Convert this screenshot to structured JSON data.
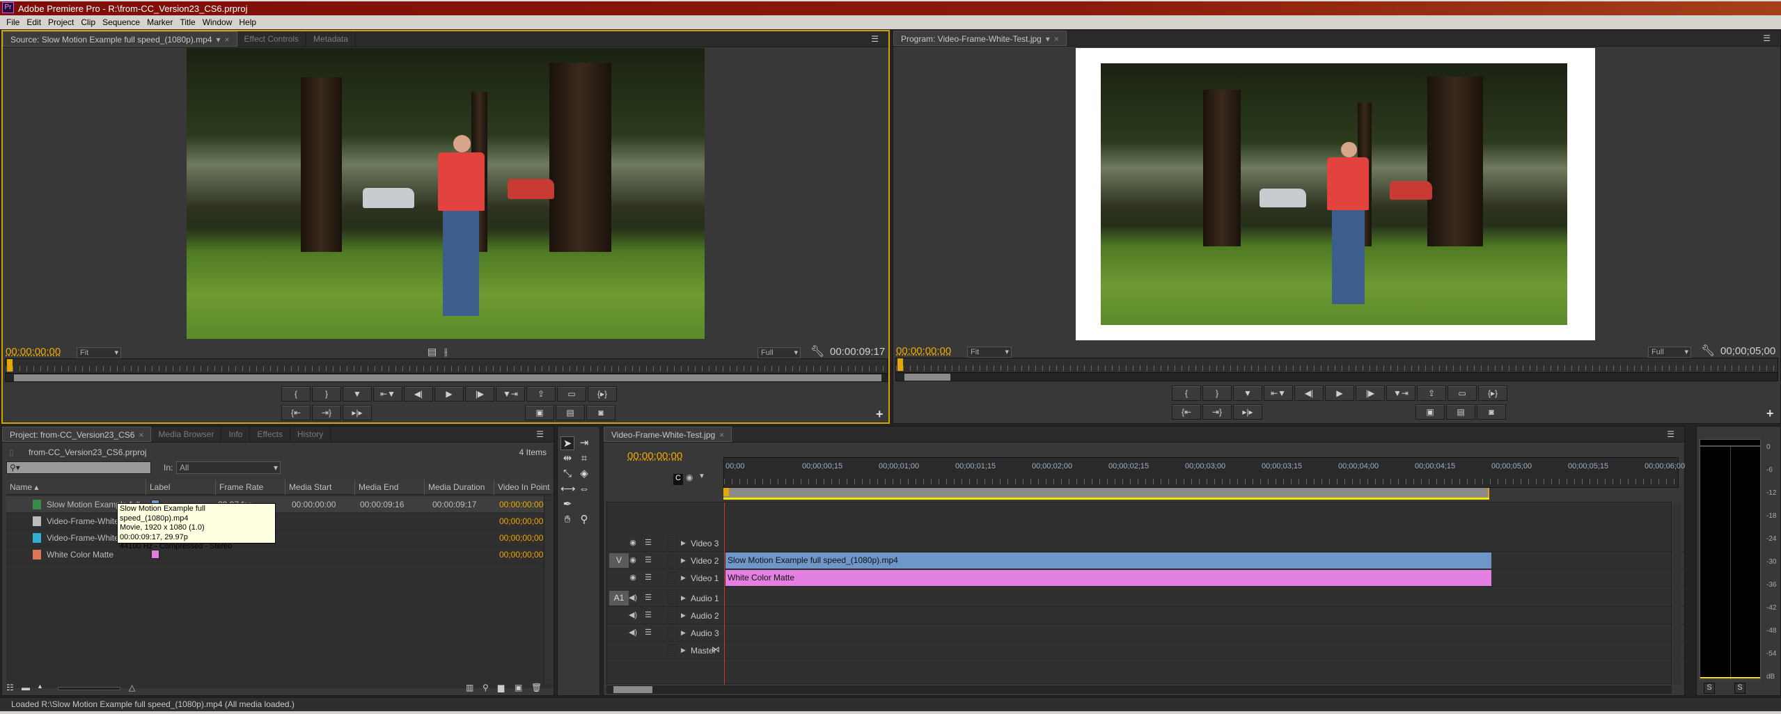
{
  "app": {
    "logo": "Pr",
    "title": "Adobe Premiere Pro - R:\\from-CC_Version23_CS6.prproj"
  },
  "menu": [
    "File",
    "Edit",
    "Project",
    "Clip",
    "Sequence",
    "Marker",
    "Title",
    "Window",
    "Help"
  ],
  "source": {
    "tabs": [
      {
        "label": "Source: Slow Motion Example  full speed_(1080p).mp4",
        "selected": true
      },
      {
        "label": "Effect Controls"
      },
      {
        "label": "Metadata"
      }
    ],
    "timecode": "00:00:00:00",
    "zoom": "Fit",
    "resolution": "Full",
    "duration": "00:00:09:17",
    "icons": [
      "film-strip-icon",
      "waveform-icon",
      "wrench-icon"
    ]
  },
  "program": {
    "tabs": [
      {
        "label": "Program: Video-Frame-White-Test.jpg",
        "selected": true
      }
    ],
    "timecode": "00;00;00;00",
    "zoom": "Fit",
    "resolution": "Full",
    "duration": "00;00;05;00"
  },
  "transport": {
    "row1": [
      "{",
      "}",
      "▼",
      "⇤▼",
      "◀|",
      "▶",
      "|▶",
      "▼⇥",
      "⇪",
      "▭",
      "{▸}"
    ],
    "source_row2_left": [
      "{⇤",
      "⇥}",
      "▸|▸"
    ],
    "source_row2_right": [
      "insert",
      "overwrite",
      "export-frame"
    ],
    "program_row2_right": [
      "lift",
      "extract",
      "export-frame"
    ]
  },
  "project": {
    "tabs": [
      {
        "label": "Project: from-CC_Version23_CS6",
        "selected": true
      },
      {
        "label": "Media Browser"
      },
      {
        "label": "Info"
      },
      {
        "label": "Effects"
      },
      {
        "label": "History"
      }
    ],
    "file": "from-CC_Version23_CS6.prproj",
    "count": "4 Items",
    "search_placeholder": "",
    "in_label": "In:",
    "in_value": "All",
    "columns": [
      "Name",
      "Label",
      "Frame Rate",
      "Media Start",
      "Media End",
      "Media Duration",
      "Video In Point"
    ],
    "rows": [
      {
        "name": "Slow Motion Example  full",
        "label_color": "#6f96c8",
        "frame_rate": "29.97 fps",
        "media_start": "00:00:00:00",
        "media_end": "00:00:09:16",
        "media_duration": "00:00:09:17",
        "video_in": "00:00:00:00",
        "icon": "movie-clip-icon"
      },
      {
        "name": "Video-Frame-White-Test.jpg",
        "label_color": "",
        "frame_rate": "",
        "media_start": "",
        "media_end": "",
        "media_duration": "",
        "video_in": "00;00;00;00",
        "icon": "still-image-icon"
      },
      {
        "name": "Video-Frame-White-Test.jpg",
        "label_color": "",
        "frame_rate": "",
        "media_start": "",
        "media_end": "",
        "media_duration": "",
        "video_in": "00;00;00;00",
        "icon": "sequence-icon"
      },
      {
        "name": "White Color Matte",
        "label_color": "#e07fe0",
        "frame_rate": "",
        "media_start": "",
        "media_end": "",
        "media_duration": "",
        "video_in": "00;00;00;00",
        "icon": "color-matte-icon"
      }
    ],
    "tooltip": [
      "Slow Motion Example   full speed_(1080p).mp4",
      "Movie, 1920 x 1080 (1.0)",
      "00:00:09:17, 29.97p",
      "44100 Hz - Compressed - Stereo"
    ]
  },
  "tools": [
    "selection",
    "track-select",
    "ripple-edit",
    "rolling-edit",
    "rate-stretch",
    "razor",
    "slip",
    "slide",
    "pen",
    "hand",
    "zoom"
  ],
  "timeline": {
    "tab": "Video-Frame-White-Test.jpg",
    "timecode": "00;00;00;00",
    "ruler": [
      "00;00",
      "00;00;00;15",
      "00;00;01;00",
      "00;00;01;15",
      "00;00;02;00",
      "00;00;02;15",
      "00;00;03;00",
      "00;00;03;15",
      "00;00;04;00",
      "00;00;04;15",
      "00;00;05;00",
      "00;00;05;15",
      "00;00;06;00"
    ],
    "tracks": [
      {
        "name": "Video 3",
        "type": "video",
        "source": ""
      },
      {
        "name": "Video 2",
        "type": "video",
        "source": "V",
        "clip": "Slow Motion Example   full speed_(1080p).mp4",
        "clip_color": "#6f96c8"
      },
      {
        "name": "Video 1",
        "type": "video",
        "source": "",
        "clip": "White Color Matte",
        "clip_color": "#e37fe0"
      },
      {
        "name": "Audio 1",
        "type": "audio",
        "source": "A1"
      },
      {
        "name": "Audio 2",
        "type": "audio",
        "source": ""
      },
      {
        "name": "Audio 3",
        "type": "audio",
        "source": ""
      },
      {
        "name": "Master",
        "type": "master",
        "source": ""
      }
    ]
  },
  "meter": {
    "scale": [
      "0",
      "-6",
      "-12",
      "-18",
      "-24",
      "-30",
      "-36",
      "-42",
      "-48",
      "-54",
      "dB"
    ],
    "solo": [
      "S",
      "S"
    ]
  },
  "status": "Loaded R:\\Slow Motion Example   full speed_(1080p).mp4 (All media loaded.)",
  "colors": {
    "accent": "#f0a800",
    "title_bar": "#8a1a0a",
    "playhead": "#e03020"
  }
}
